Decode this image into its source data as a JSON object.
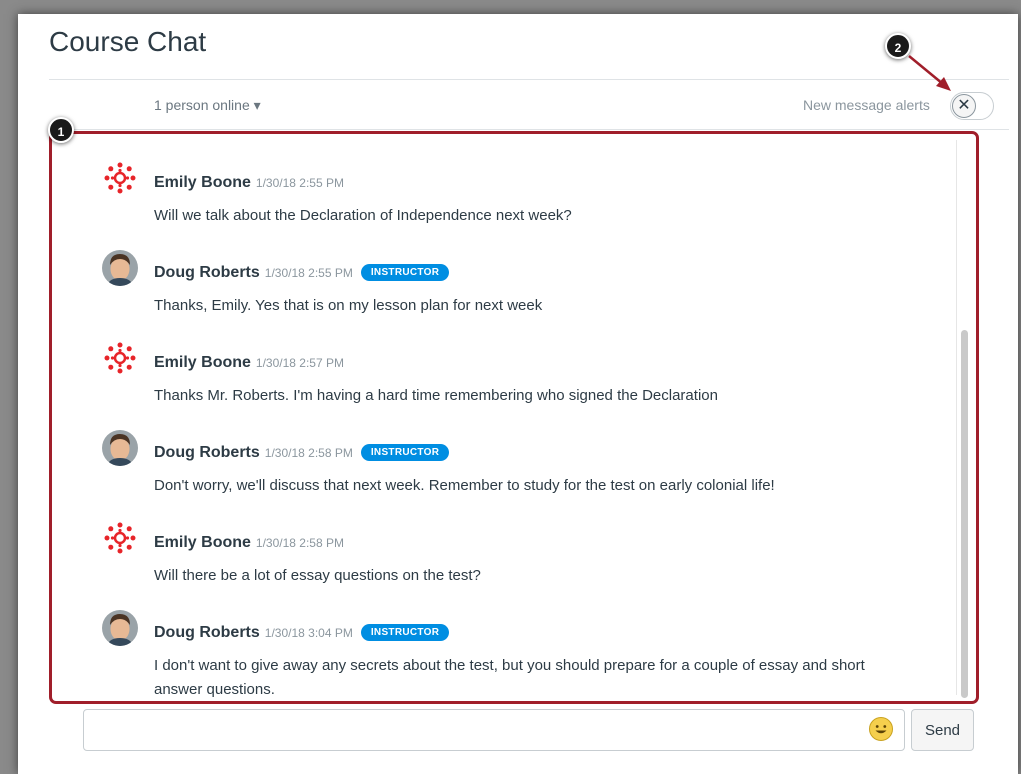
{
  "header": {
    "title": "Course Chat",
    "online_status": "1 person online",
    "online_caret": "▾",
    "alerts_label": "New message alerts",
    "alerts_toggle_glyph": "✕",
    "alerts_enabled": false
  },
  "callouts": [
    "1",
    "2"
  ],
  "messages": [
    {
      "author": "Emily Boone",
      "time": "1/30/18 2:55 PM",
      "badge": "",
      "avatar": "canvas-logo-icon",
      "lines": [
        "Will we talk about the Declaration of Independence next week?"
      ]
    },
    {
      "author": "Doug Roberts",
      "time": "1/30/18 2:55 PM",
      "badge": "INSTRUCTOR",
      "avatar": "user-photo",
      "lines": [
        "Thanks, Emily. Yes that is on my lesson plan for next week"
      ]
    },
    {
      "author": "Emily Boone",
      "time": "1/30/18 2:57 PM",
      "badge": "",
      "avatar": "canvas-logo-icon",
      "lines": [
        "Thanks Mr. Roberts. I'm having a hard time remembering who signed the Declaration"
      ]
    },
    {
      "author": "Doug Roberts",
      "time": "1/30/18 2:58 PM",
      "badge": "INSTRUCTOR",
      "avatar": "user-photo",
      "lines": [
        "Don't worry, we'll discuss that next week. Remember to study for the test on early colonial life!"
      ]
    },
    {
      "author": "Emily Boone",
      "time": "1/30/18 2:58 PM",
      "badge": "",
      "avatar": "canvas-logo-icon",
      "lines": [
        "Will there be a lot of essay questions on the test?"
      ]
    },
    {
      "author": "Doug Roberts",
      "time": "1/30/18 3:04 PM",
      "badge": "INSTRUCTOR",
      "avatar": "user-photo",
      "lines": [
        "I don't want to give away any secrets about the test, but you should prepare for a couple of essay and short",
        "answer questions."
      ]
    }
  ],
  "composer": {
    "placeholder": "",
    "value": "",
    "send_label": "Send",
    "emoji_icon": "smiley-emoji-icon"
  },
  "colors": {
    "accent_red": "#a01e2a",
    "badge_blue": "#008ee2",
    "canvas_red": "#e72429",
    "text": "#2d3b45"
  }
}
